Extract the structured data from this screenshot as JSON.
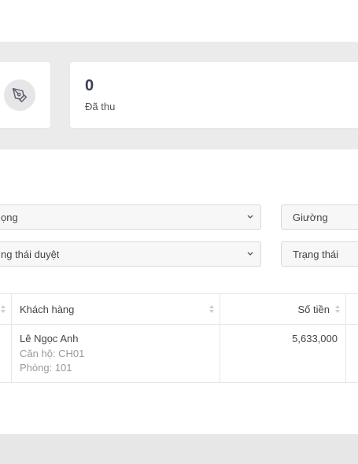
{
  "stats": {
    "left_icon": "pen-tool-icon",
    "paid_value": "0",
    "paid_label": "Đã thu"
  },
  "filters": {
    "building_select": "ọng",
    "approval_status_select": "ng thái duyệt",
    "bed_select": "Giường",
    "status_select": "Trạng thái"
  },
  "table": {
    "headers": {
      "customer": "Khách hàng",
      "amount": "Số tiền"
    },
    "rows": [
      {
        "customer_name": "Lê Ngọc Anh",
        "apartment": "Căn hộ: CH01",
        "room": "Phòng: 101",
        "amount": "5,633,000"
      }
    ]
  }
}
